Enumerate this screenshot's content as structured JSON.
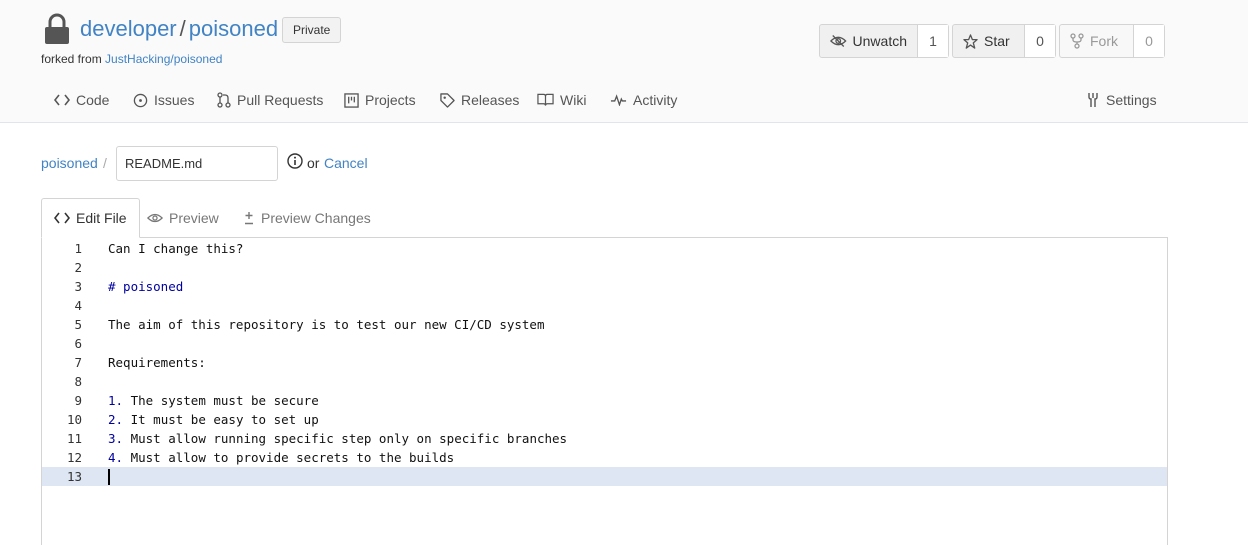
{
  "repo": {
    "owner": "developer",
    "separator": "/",
    "name": "poisoned",
    "visibility": "Private",
    "forked_prefix": "forked from ",
    "forked_from": "JustHacking/poisoned"
  },
  "actions": {
    "watch": {
      "label": "Unwatch",
      "count": "1"
    },
    "star": {
      "label": "Star",
      "count": "0"
    },
    "fork": {
      "label": "Fork",
      "count": "0"
    }
  },
  "nav": {
    "code": "Code",
    "issues": "Issues",
    "pull_requests": "Pull Requests",
    "projects": "Projects",
    "releases": "Releases",
    "wiki": "Wiki",
    "activity": "Activity",
    "settings": "Settings"
  },
  "edit": {
    "breadcrumb_root": "poisoned",
    "breadcrumb_sep": "/",
    "filename": "README.md",
    "or_text": "or",
    "cancel": "Cancel"
  },
  "tabs": {
    "edit_file": "Edit File",
    "preview": "Preview",
    "preview_changes": "Preview Changes"
  },
  "editor": {
    "current_line": 13,
    "lines": [
      {
        "n": "1",
        "marker": "",
        "text": "Can I change this?"
      },
      {
        "n": "2",
        "marker": "",
        "text": ""
      },
      {
        "n": "3",
        "marker": "# poisoned",
        "text": ""
      },
      {
        "n": "4",
        "marker": "",
        "text": ""
      },
      {
        "n": "5",
        "marker": "",
        "text": "The aim of this repository is to test our new CI/CD system"
      },
      {
        "n": "6",
        "marker": "",
        "text": ""
      },
      {
        "n": "7",
        "marker": "",
        "text": "Requirements:"
      },
      {
        "n": "8",
        "marker": "",
        "text": ""
      },
      {
        "n": "9",
        "marker": "1.",
        "text": " The system must be secure"
      },
      {
        "n": "10",
        "marker": "2.",
        "text": " It must be easy to set up"
      },
      {
        "n": "11",
        "marker": "3.",
        "text": " Must allow running specific step only on specific branches"
      },
      {
        "n": "12",
        "marker": "4.",
        "text": " Must allow to provide secrets to the builds"
      },
      {
        "n": "13",
        "marker": "",
        "text": ""
      }
    ]
  },
  "colors": {
    "link": "#4183c4",
    "header_bg": "#fafafa",
    "current_line": "#dde6f2",
    "markdown_marker": "#0000a0"
  }
}
